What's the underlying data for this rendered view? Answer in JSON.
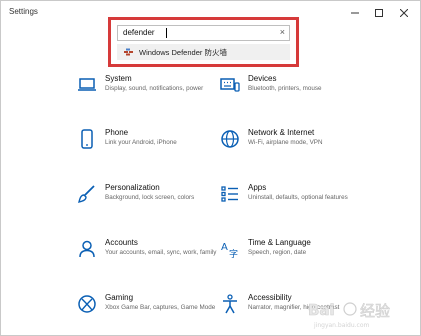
{
  "window": {
    "title": "Settings"
  },
  "search": {
    "value": "defender",
    "suggestion": "Windows Defender 防火墙"
  },
  "tiles": [
    {
      "name": "System",
      "desc": "Display, sound, notifications, power",
      "icon": "laptop-icon"
    },
    {
      "name": "Devices",
      "desc": "Bluetooth, printers, mouse",
      "icon": "keyboard-icon"
    },
    {
      "name": "Phone",
      "desc": "Link your Android, iPhone",
      "icon": "phone-icon"
    },
    {
      "name": "Network & Internet",
      "desc": "Wi-Fi, airplane mode, VPN",
      "icon": "globe-icon"
    },
    {
      "name": "Personalization",
      "desc": "Background, lock screen, colors",
      "icon": "brush-icon"
    },
    {
      "name": "Apps",
      "desc": "Uninstall, defaults, optional features",
      "icon": "apps-icon"
    },
    {
      "name": "Accounts",
      "desc": "Your accounts, email, sync, work, family",
      "icon": "person-icon"
    },
    {
      "name": "Time & Language",
      "desc": "Speech, region, date",
      "icon": "language-icon"
    },
    {
      "name": "Gaming",
      "desc": "Xbox Game Bar, captures, Game Mode",
      "icon": "xbox-icon"
    },
    {
      "name": "Accessibility",
      "desc": "Narrator, magnifier, high contrast",
      "icon": "accessibility-icon"
    }
  ],
  "watermark": {
    "text": "Baidu 经验"
  },
  "colors": {
    "accent": "#0a5fb4",
    "highlight": "#d63a3a"
  }
}
